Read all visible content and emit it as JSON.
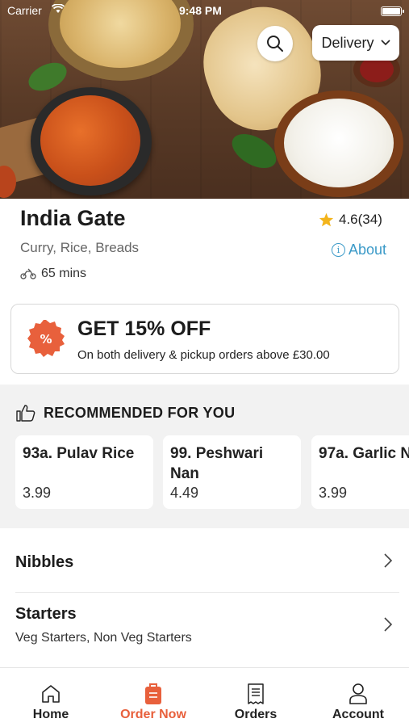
{
  "status_bar": {
    "carrier": "Carrier",
    "time": "9:48 PM"
  },
  "hero": {
    "delivery_mode": "Delivery"
  },
  "restaurant": {
    "name": "India Gate",
    "rating": "4.6(34)",
    "cuisines": "Curry, Rice, Breads",
    "about_label": "About",
    "delivery_time": "65 mins"
  },
  "offer": {
    "title": "GET 15% OFF",
    "subtitle": "On both delivery & pickup orders above £30.00"
  },
  "recommended": {
    "heading": "RECOMMENDED FOR YOU",
    "items": [
      {
        "line1": "93a. Pulav Rice",
        "line2": "",
        "price": "3.99"
      },
      {
        "line1": "99. Peshwari",
        "line2": "Nan",
        "price": "4.49"
      },
      {
        "line1": "97a. Garlic N",
        "line2": "",
        "price": "3.99"
      }
    ]
  },
  "categories": [
    {
      "title": "Nibbles",
      "subtitle": ""
    },
    {
      "title": "Starters",
      "subtitle": "Veg Starters, Non Veg Starters"
    }
  ],
  "tabs": [
    {
      "label": "Home",
      "icon": "home-icon"
    },
    {
      "label": "Order Now",
      "icon": "order-bag-icon"
    },
    {
      "label": "Orders",
      "icon": "receipt-icon"
    },
    {
      "label": "Account",
      "icon": "account-icon"
    }
  ],
  "colors": {
    "accent": "#e8603c",
    "link": "#3b9ac8",
    "star": "#f3b41b"
  }
}
